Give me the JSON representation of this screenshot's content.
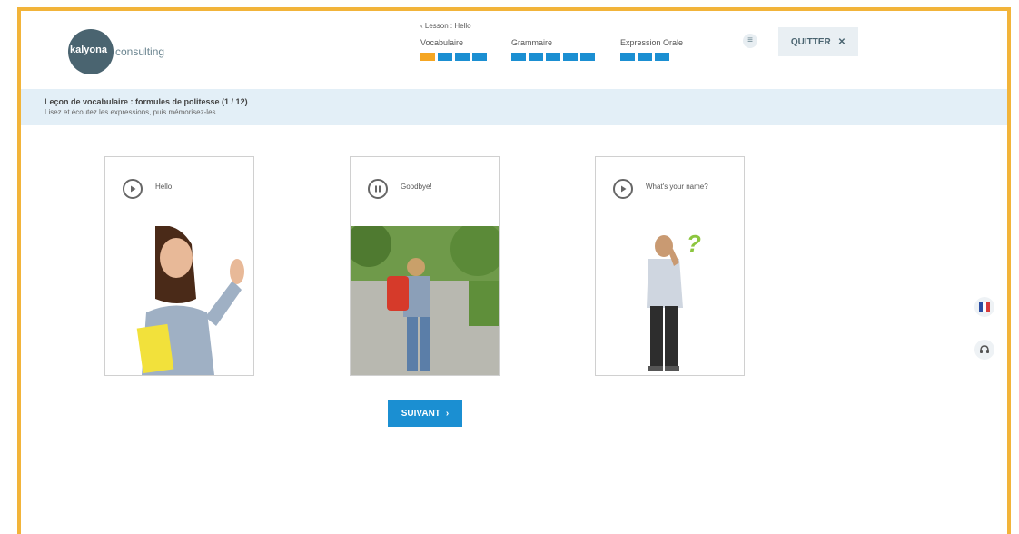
{
  "header": {
    "logo_brand": "kalyona",
    "logo_sub": "consulting",
    "breadcrumb": "‹ Lesson : Hello",
    "modules": [
      {
        "label": "Vocabulaire",
        "steps": 4,
        "current": 0
      },
      {
        "label": "Grammaire",
        "steps": 5,
        "current": -1
      },
      {
        "label": "Expression Orale",
        "steps": 3,
        "current": -1
      }
    ],
    "menu_icon": "menu-icon",
    "quit_label": "QUITTER",
    "quit_icon": "✕"
  },
  "instruction": {
    "title": "Leçon de vocabulaire : formules de politesse (1 / 12)",
    "subtitle": "Lisez et écoutez les expressions, puis mémorisez-les."
  },
  "cards": [
    {
      "label": "Hello!",
      "state": "play"
    },
    {
      "label": "Goodbye!",
      "state": "pause"
    },
    {
      "label": "What's your name?",
      "state": "play"
    }
  ],
  "next_button": {
    "label": "SUIVANT",
    "icon": "›"
  },
  "side": {
    "flag_icon": "flag-fr-icon",
    "headset_icon": "headset-icon"
  },
  "colors": {
    "accent": "#1b8fd2",
    "frame": "#f2b43a",
    "current_step": "#f5a623",
    "band": "#e3eff7"
  }
}
